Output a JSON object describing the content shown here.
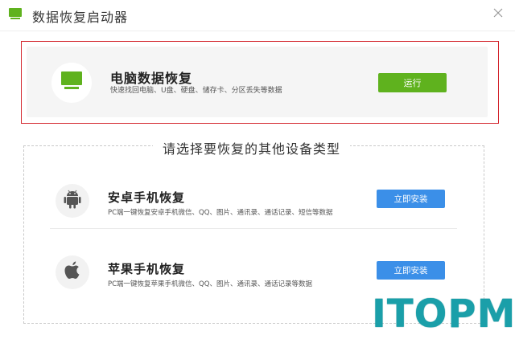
{
  "window": {
    "title": "数据恢复启动器",
    "close_icon": "close-icon"
  },
  "colors": {
    "accent_green": "#5fb21e",
    "accent_blue": "#3b8fe8",
    "highlight_red": "#d3242c",
    "watermark_teal": "#1a9fa9"
  },
  "pc_recovery": {
    "icon": "monitor-icon",
    "title": "电脑数据恢复",
    "description": "快速找回电脑、U盘、硬盘、储存卡、分区丢失等数据",
    "button_label": "运行"
  },
  "other_devices": {
    "section_title": "请选择要恢复的其他设备类型",
    "items": [
      {
        "icon": "android-icon",
        "title": "安卓手机恢复",
        "description": "PC端一键恢复安卓手机微信、QQ、图片、通讯录、通话记录、短信等数据",
        "button_label": "立即安装"
      },
      {
        "icon": "apple-icon",
        "title": "苹果手机恢复",
        "description": "PC端一键恢复苹果手机微信、QQ、图片、通讯录、通话记录等数据",
        "button_label": "立即安装"
      }
    ]
  },
  "watermark": {
    "text": "ITOPM"
  }
}
